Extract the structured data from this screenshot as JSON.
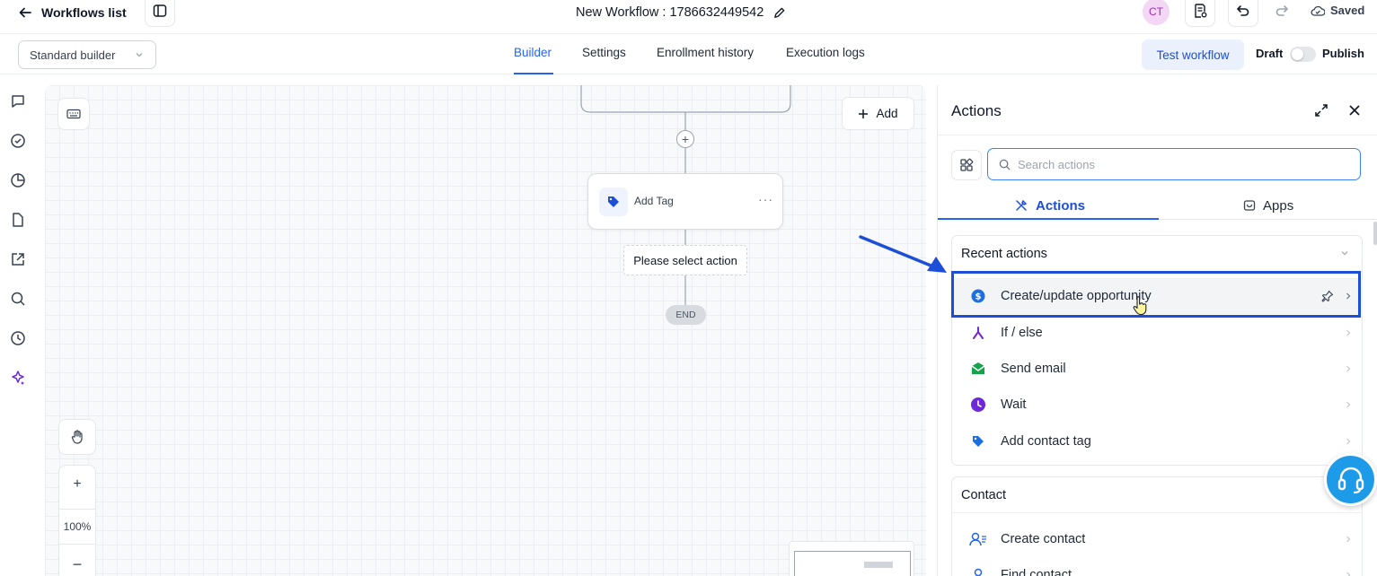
{
  "header": {
    "back_label": "Workflows list",
    "workflow_title": "New Workflow : 1786632449542",
    "avatar_initials": "CT",
    "saved_label": "Saved"
  },
  "subbar": {
    "builder_select": "Standard builder",
    "tabs": [
      {
        "label": "Builder",
        "active": true
      },
      {
        "label": "Settings",
        "active": false
      },
      {
        "label": "Enrollment history",
        "active": false
      },
      {
        "label": "Execution logs",
        "active": false
      }
    ],
    "test_button": "Test workflow",
    "draft_label": "Draft",
    "publish_label": "Publish",
    "publish_on": false
  },
  "rail": {
    "icons": [
      "chat-icon",
      "check-circle-icon",
      "pie-chart-icon",
      "document-icon",
      "external-link-icon",
      "search-icon",
      "history-icon",
      "sparkle-icon"
    ]
  },
  "canvas": {
    "add_label": "Add",
    "node_label": "Add Tag",
    "node_more": "···",
    "select_action": "Please select action",
    "end_label": "END",
    "zoom_plus": "+",
    "zoom_level": "100%",
    "zoom_minus": "−"
  },
  "panel": {
    "title": "Actions",
    "search_placeholder": "Search actions",
    "tabs": [
      {
        "label": "Actions",
        "active": true
      },
      {
        "label": "Apps",
        "active": false
      }
    ],
    "recent": {
      "title": "Recent actions",
      "items": [
        {
          "label": "Create/update opportunity",
          "icon": "dollar-icon",
          "highlighted": true
        },
        {
          "label": "If / else",
          "icon": "branch-icon"
        },
        {
          "label": "Send email",
          "icon": "email-icon"
        },
        {
          "label": "Wait",
          "icon": "clock-icon"
        },
        {
          "label": "Add contact tag",
          "icon": "tag-icon"
        }
      ]
    },
    "contact": {
      "title": "Contact",
      "items": [
        {
          "label": "Create contact",
          "icon": "contact-icon"
        },
        {
          "label": "Find contact",
          "icon": "user-icon"
        }
      ]
    }
  },
  "colors": {
    "accent": "#2563eb",
    "highlight_border": "#1d4ed8",
    "support": "#1e9be8"
  }
}
